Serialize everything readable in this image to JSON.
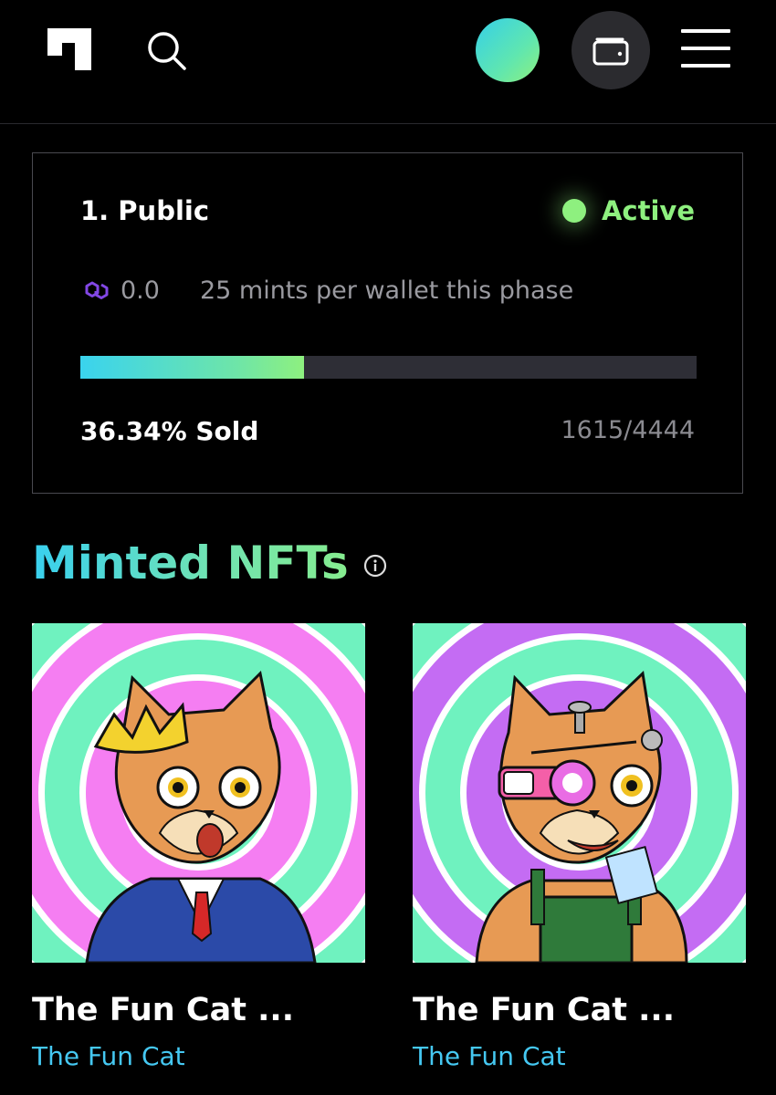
{
  "header": {
    "logo_icon": "square-logo-icon",
    "search_icon": "search-icon",
    "avatar_icon": "gradient-avatar",
    "wallet_icon": "wallet-icon",
    "menu_icon": "hamburger-menu-icon"
  },
  "phase": {
    "name": "1. Public",
    "status": "Active",
    "status_color": "#8ef07f",
    "currency_icon": "polygon-icon",
    "price": "0.0",
    "limit_text": "25 mints per wallet this phase",
    "progress_fraction": 0.3634,
    "sold_text": "36.34% Sold",
    "count_text": "1615/4444"
  },
  "minted": {
    "title": "Minted NFTs",
    "info_icon": "info-icon",
    "items": [
      {
        "title": "The Fun Cat ...",
        "collection": "The Fun Cat",
        "ring_color": "#f57ef2",
        "alt_ring": "#6ff2bf"
      },
      {
        "title": "The Fun Cat ...",
        "collection": "The Fun Cat",
        "ring_color": "#c46cf3",
        "alt_ring": "#6ff2bf"
      }
    ]
  },
  "colors": {
    "accent_cyan": "#39d0ef",
    "accent_green": "#8ef07f",
    "link_blue": "#45c8f2"
  }
}
